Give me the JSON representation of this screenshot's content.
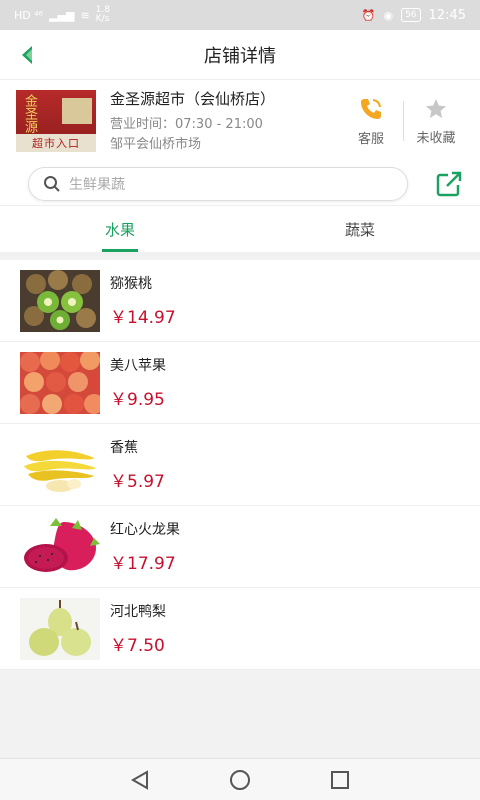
{
  "status_bar": {
    "left_text": "HD ⁴⁶",
    "speed": "1.8\nK/s",
    "battery": "56",
    "time": "12:45"
  },
  "nav": {
    "title": "店铺详情"
  },
  "store": {
    "name": "金圣源超市（会仙桥店）",
    "hours": "营业时间：07:30 - 21:00",
    "address": "邹平会仙桥市场",
    "thumb_sign_top": "金圣源",
    "thumb_sign_bottom": "超市入口",
    "service_label": "客服",
    "favorite_label": "未收藏"
  },
  "search": {
    "placeholder": "生鲜果蔬"
  },
  "tabs": [
    {
      "label": "水果",
      "active": true
    },
    {
      "label": "蔬菜",
      "active": false
    }
  ],
  "products": [
    {
      "name": "猕猴桃",
      "price": "￥14.97"
    },
    {
      "name": "美八苹果",
      "price": "￥9.95"
    },
    {
      "name": "香蕉",
      "price": "￥5.97"
    },
    {
      "name": "红心火龙果",
      "price": "￥17.97"
    },
    {
      "name": "河北鸭梨",
      "price": "￥7.50"
    }
  ],
  "colors": {
    "accent": "#1aa260",
    "price": "#c8102e",
    "service_icon": "#f5a623"
  }
}
